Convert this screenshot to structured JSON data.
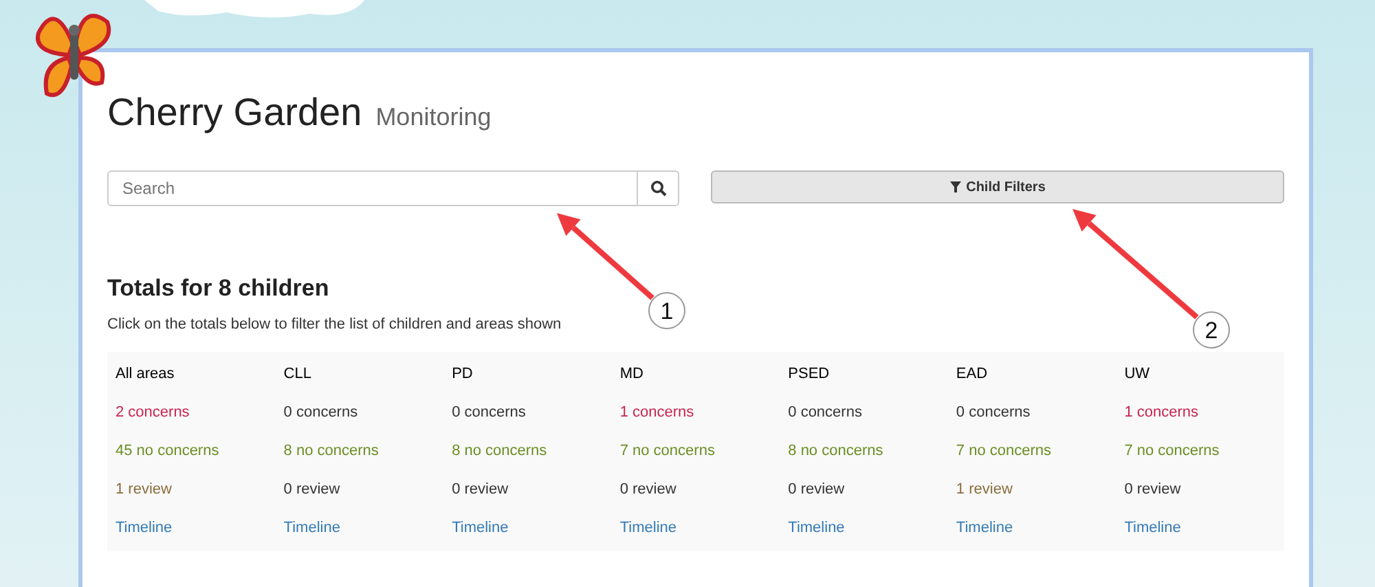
{
  "header": {
    "title": "Cherry Garden",
    "subtitle": "Monitoring"
  },
  "search": {
    "placeholder": "Search"
  },
  "filter_button": {
    "label": "Child Filters"
  },
  "totals": {
    "heading": "Totals for 8 children",
    "hint": "Click on the totals below to filter the list of children and areas shown",
    "columns": [
      {
        "area": "All areas",
        "cells": [
          {
            "kind": "alert",
            "text": "2 concerns"
          },
          {
            "kind": "ok",
            "text": "45 no concerns"
          },
          {
            "kind": "review",
            "text": "1 review"
          },
          {
            "kind": "link",
            "text": "Timeline"
          }
        ]
      },
      {
        "area": "CLL",
        "cells": [
          {
            "kind": "plain",
            "text": "0 concerns"
          },
          {
            "kind": "ok",
            "text": "8 no concerns"
          },
          {
            "kind": "plain",
            "text": "0 review"
          },
          {
            "kind": "link",
            "text": "Timeline"
          }
        ]
      },
      {
        "area": "PD",
        "cells": [
          {
            "kind": "plain",
            "text": "0 concerns"
          },
          {
            "kind": "ok",
            "text": "8 no concerns"
          },
          {
            "kind": "plain",
            "text": "0 review"
          },
          {
            "kind": "link",
            "text": "Timeline"
          }
        ]
      },
      {
        "area": "MD",
        "cells": [
          {
            "kind": "alert",
            "text": "1 concerns"
          },
          {
            "kind": "ok",
            "text": "7 no concerns"
          },
          {
            "kind": "plain",
            "text": "0 review"
          },
          {
            "kind": "link",
            "text": "Timeline"
          }
        ]
      },
      {
        "area": "PSED",
        "cells": [
          {
            "kind": "plain",
            "text": "0 concerns"
          },
          {
            "kind": "ok",
            "text": "8 no concerns"
          },
          {
            "kind": "plain",
            "text": "0 review"
          },
          {
            "kind": "link",
            "text": "Timeline"
          }
        ]
      },
      {
        "area": "EAD",
        "cells": [
          {
            "kind": "plain",
            "text": "0 concerns"
          },
          {
            "kind": "ok",
            "text": "7 no concerns"
          },
          {
            "kind": "review",
            "text": "1 review"
          },
          {
            "kind": "link",
            "text": "Timeline"
          }
        ]
      },
      {
        "area": "UW",
        "cells": [
          {
            "kind": "alert",
            "text": "1 concerns"
          },
          {
            "kind": "ok",
            "text": "7 no concerns"
          },
          {
            "kind": "plain",
            "text": "0 review"
          },
          {
            "kind": "link",
            "text": "Timeline"
          }
        ]
      }
    ]
  },
  "callouts": [
    {
      "number": "1"
    },
    {
      "number": "2"
    }
  ]
}
